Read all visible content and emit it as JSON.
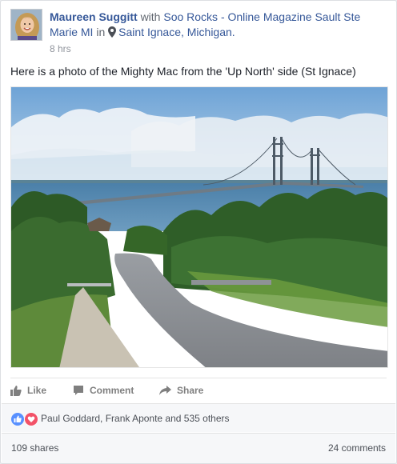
{
  "post": {
    "author": "Maureen Suggitt",
    "with_word": "with",
    "tagged_page": "Soo Rocks - Online Magazine Sault Ste Marie MI",
    "in_word": "in",
    "location": "Saint Ignace, Michigan.",
    "time": "8 hrs",
    "caption": "Here is a photo of the Mighty Mac from the 'Up North' side (St Ignace)"
  },
  "actions": {
    "like": "Like",
    "comment": "Comment",
    "share": "Share"
  },
  "reactions": {
    "summary": "Paul Goddard, Frank Aponte and 535 others",
    "icons": [
      "like-icon",
      "love-icon"
    ]
  },
  "stats": {
    "shares": "109 shares",
    "comments": "24 comments"
  },
  "colors": {
    "link": "#365899",
    "like_blue": "#5890ff",
    "love_red": "#f25268",
    "action_grey": "#7f7f7f"
  }
}
